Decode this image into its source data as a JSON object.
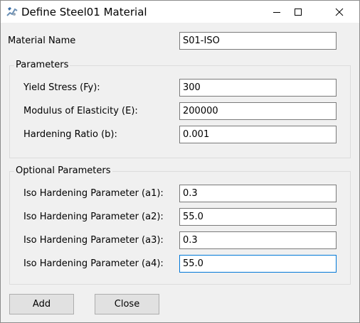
{
  "window": {
    "title": "Define Steel01 Material",
    "icon": "steel-material-app-icon"
  },
  "material_name": {
    "label": "Material Name",
    "value": "S01-ISO"
  },
  "parameters": {
    "title": "Parameters",
    "fields": [
      {
        "label": "Yield Stress (Fy):",
        "value": "300"
      },
      {
        "label": "Modulus of Elasticity (E):",
        "value": "200000"
      },
      {
        "label": "Hardening Ratio (b):",
        "value": "0.001"
      }
    ]
  },
  "optional_parameters": {
    "title": "Optional Parameters",
    "fields": [
      {
        "label": "Iso Hardening Parameter (a1):",
        "value": "0.3"
      },
      {
        "label": "Iso Hardening Parameter (a2):",
        "value": "55.0"
      },
      {
        "label": "Iso Hardening Parameter (a3):",
        "value": "0.3"
      },
      {
        "label": "Iso Hardening Parameter (a4):",
        "value": "55.0"
      }
    ]
  },
  "buttons": {
    "add": "Add",
    "close": "Close"
  },
  "colors": {
    "dialog_background": "#f0f0f0",
    "focus_border": "#0078d7"
  }
}
